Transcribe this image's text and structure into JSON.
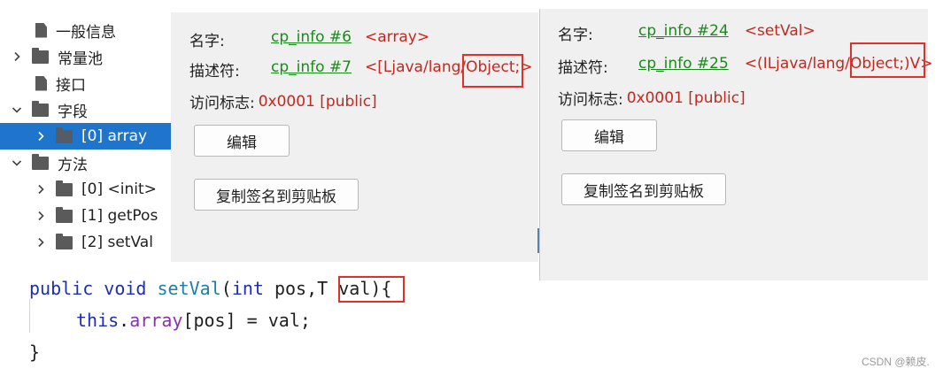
{
  "tree": {
    "items": [
      {
        "label": "一般信息",
        "expand": "",
        "icon": "file-icon"
      },
      {
        "label": "常量池",
        "expand": "collapsed",
        "icon": "folder-icon"
      },
      {
        "label": "接口",
        "expand": "",
        "icon": "file-icon"
      },
      {
        "label": "字段",
        "expand": "expanded",
        "icon": "folder-icon"
      },
      {
        "label": "[0] array",
        "expand": "collapsed",
        "icon": "folder-icon",
        "selected": true
      },
      {
        "label": "方法",
        "expand": "expanded",
        "icon": "folder-icon"
      },
      {
        "label": "[0] <init>",
        "expand": "collapsed",
        "icon": "folder-icon"
      },
      {
        "label": "[1] getPos",
        "expand": "collapsed",
        "icon": "folder-icon"
      },
      {
        "label": "[2] setVal",
        "expand": "collapsed",
        "icon": "folder-icon"
      }
    ]
  },
  "left_panel": {
    "name_label": "名字:",
    "name_link": "cp_info #6",
    "name_value": "<array>",
    "desc_label": "描述符:",
    "desc_link": "cp_info #7",
    "desc_value": "<[Ljava/lang/Object;>",
    "access_label": "访问标志:",
    "access_value": "0x0001 [public]",
    "edit_button": "编辑",
    "copy_button": "复制签名到剪贴板"
  },
  "right_panel": {
    "name_label": "名字:",
    "name_link": "cp_info #24",
    "name_value": "<setVal>",
    "desc_label": "描述符:",
    "desc_link": "cp_info #25",
    "desc_value": "<(ILjava/lang/Object;)V>",
    "access_label": "访问标志:",
    "access_value": "0x0001 [public]",
    "edit_button": "编辑",
    "copy_button": "复制签名到剪贴板"
  },
  "code": {
    "line1": {
      "kw1": "public",
      "kw2": "void",
      "fn": "setVal",
      "open": "(",
      "kw3": "int",
      "param1": " pos,",
      "param2": "T val",
      "close": "){"
    },
    "line2": {
      "kw": "this",
      "dot": ".",
      "field": "array",
      "rest": "[pos] = val;"
    },
    "line3": {
      "brace": "}"
    }
  },
  "watermark": "CSDN @赖皮.",
  "colors": {
    "link": "#1a8a1a",
    "value": "#c4271e",
    "highlight": "#e0302a",
    "selection": "#1f75cc"
  }
}
